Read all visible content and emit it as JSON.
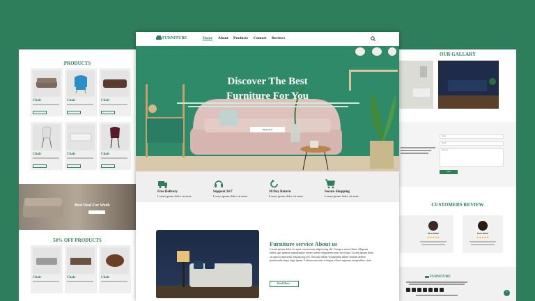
{
  "left": {
    "products_title": "PRODUCTS",
    "products": [
      {
        "name": "Chair"
      },
      {
        "name": "Chair"
      },
      {
        "name": "Chair"
      },
      {
        "name": "Chair"
      },
      {
        "name": "Chair"
      },
      {
        "name": "Chair"
      }
    ],
    "banner_text": "Best Deal For Week",
    "offer_title": "50% OFF PRODUCTS",
    "offer_products": [
      {
        "name": "Chair"
      },
      {
        "name": "Chair"
      },
      {
        "name": "Chair"
      }
    ]
  },
  "nav": {
    "logo": "FURNITURE",
    "links": [
      "Home",
      "About",
      "Products",
      "Contact",
      "Reviews"
    ]
  },
  "hero": {
    "title_line1": "Discover The Best",
    "title_line2": "Furniture For You",
    "button": "Shop Now"
  },
  "features": [
    {
      "title": "Free Delivery",
      "sub": "Lorem ipsum dolor sit amet",
      "icon": "truck-icon"
    },
    {
      "title": "Support 24/7",
      "sub": "Lorem ipsum dolor sit amet",
      "icon": "headset-icon"
    },
    {
      "title": "30 Day Return",
      "sub": "Lorem ipsum dolor sit amet",
      "icon": "return-icon"
    },
    {
      "title": "Secure Shopping",
      "sub": "Lorem ipsum dolor sit amet",
      "icon": "cart-icon"
    }
  ],
  "about": {
    "title": "Furniture service About us",
    "text": "Lorem ipsum dolor sit amet consectetur adipisicing elit. Compor more illum. Aliquam eniesi quo quaerat repudiandae rerum ratem voluptatem eum iucid quo. Lorem ipsum dolor sit amet consectetur adipisicing elit. Suscipit ullam voluptatem ullam veniam debitis perferendis atque fuga ipsam. Laboriosam rem voluptas officia sapiente temporibus vitae.",
    "button": "Read More..."
  },
  "right": {
    "gallery_title": "OUR GALLARY",
    "contact_fields": [
      "Name",
      "Email",
      "Message"
    ],
    "send_label": "Send",
    "reviews_title": "CUSTOMERS REVIEW",
    "reviews": [
      {
        "name": "Elon Mark",
        "stars": "★★★★★"
      },
      {
        "name": "Elon Mark",
        "stars": "★★★★★"
      }
    ],
    "footer_logo": "FURNITURE"
  },
  "colors": {
    "accent": "#2e7d5b",
    "background": "#2e7d5b"
  }
}
